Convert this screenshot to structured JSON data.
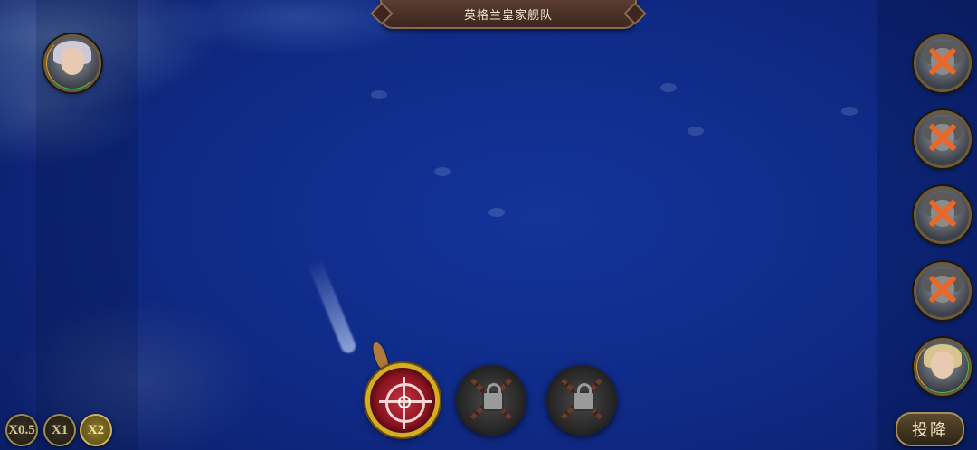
{
  "header": {
    "fleet_name": "英格兰皇家舰队"
  },
  "player": {
    "portrait_icon": "admiral-portrait"
  },
  "enemies": [
    {
      "status": "defeated",
      "icon": "enemy-captain-portrait"
    },
    {
      "status": "defeated",
      "icon": "enemy-captain-portrait"
    },
    {
      "status": "defeated",
      "icon": "enemy-captain-portrait"
    },
    {
      "status": "defeated",
      "icon": "enemy-captain-portrait"
    },
    {
      "status": "active",
      "icon": "enemy-captain-portrait"
    }
  ],
  "skills": [
    {
      "icon": "crosshair-icon",
      "locked": false
    },
    {
      "icon": "lock-icon",
      "locked": true
    },
    {
      "icon": "lock-icon",
      "locked": true
    }
  ],
  "speed": {
    "options": [
      "X0.5",
      "X1",
      "X2"
    ],
    "selected": "X2"
  },
  "surrender_label": "投降",
  "colors": {
    "ocean": "#0f2a86",
    "health_green": "#3cc24a",
    "health_orange": "#f0a020",
    "defeat_mark": "#e8672a",
    "aim_gold": "#d4ae22"
  }
}
